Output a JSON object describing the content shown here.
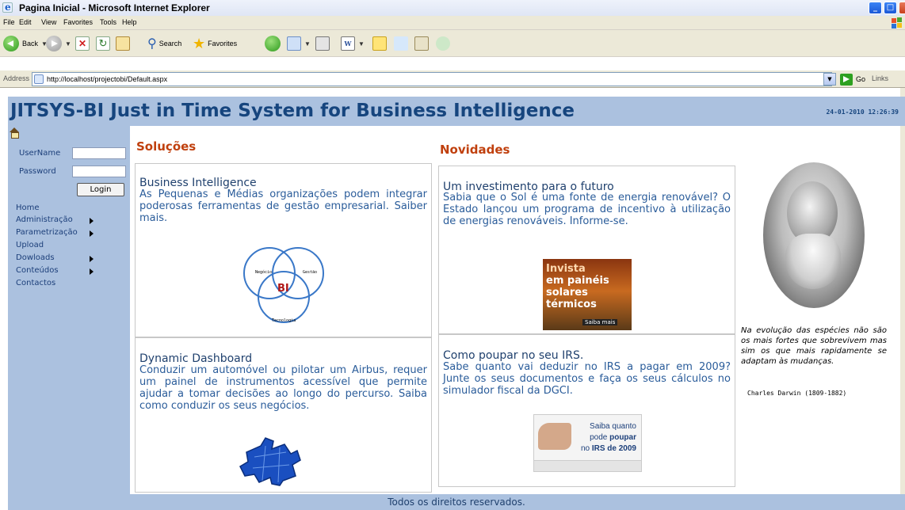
{
  "window": {
    "title": "Pagina Inicial - Microsoft Internet Explorer"
  },
  "menu": [
    "File",
    "Edit",
    "View",
    "Favorites",
    "Tools",
    "Help"
  ],
  "toolbar": {
    "back_label": "Back",
    "search_label": "Search",
    "favorites_label": "Favorites"
  },
  "address": {
    "label": "Address",
    "url": "http://localhost/projectobi/Default.aspx",
    "go_label": "Go",
    "links_label": "Links"
  },
  "banner": {
    "title": "JITSYS-BI Just in Time System for Business Intelligence",
    "datetime": "24-01-2010 12:26:39"
  },
  "login": {
    "username_label": "UserName",
    "password_label": "Password",
    "username_value": "",
    "password_value": "",
    "button_label": "Login"
  },
  "nav": [
    {
      "label": "Home",
      "submenu": false
    },
    {
      "label": "Administração",
      "submenu": true
    },
    {
      "label": "Parametrização",
      "submenu": true
    },
    {
      "label": "Upload",
      "submenu": false
    },
    {
      "label": "Dowloads",
      "submenu": true
    },
    {
      "label": "Conteúdos",
      "submenu": true
    },
    {
      "label": "Contactos",
      "submenu": false
    }
  ],
  "solucoes": {
    "heading": "Soluções",
    "cards": [
      {
        "title": "Business Intelligence",
        "text": "As Pequenas e Médias organizações podem integrar poderosas ferramentas de gestão empresarial. Saiber mais.",
        "diagram": {
          "top_left": "Negócio",
          "top_right": "Gestão",
          "bottom": "Tecnologia",
          "center": "BI"
        }
      },
      {
        "title": "Dynamic Dashboard",
        "text": "Conduzir um automóvel ou pilotar um Airbus, requer um painel de instrumentos acessível que permite ajudar a tomar decisões ao longo do percurso. Saiba como conduzir os seus negócios."
      }
    ]
  },
  "novidades": {
    "heading": "Novidades",
    "cards": [
      {
        "title": "Um investimento para o futuro",
        "text": "Sabia que o Sol é uma fonte de energia renovável? O Estado lançou um programa de incentivo à utilização de energias renováveis. Informe-se.",
        "ad_lines": [
          "Invista",
          "em painéis",
          "solares",
          "térmicos"
        ],
        "ad_button": "Saiba mais"
      },
      {
        "title": "Como poupar no seu IRS.",
        "text": "Sabe quanto vai deduzir no IRS a pagar em 2009? Junte os seus documentos e faça os seus cálculos no simulador fiscal da DGCI.",
        "ad_line1": "Saiba quanto",
        "ad_line2_pre": "pode ",
        "ad_line2_bold": "poupar",
        "ad_line3_pre": "no ",
        "ad_line3_bold": "IRS de 2009"
      }
    ]
  },
  "quote": {
    "text": "Na evolução das espécies não são os mais fortes que sobrevivem mas sim os que mais rapidamente se adaptam às mudanças.",
    "author": "Charles Darwin (1809-1882)"
  },
  "footer": {
    "text": "Todos os direitos reservados."
  }
}
